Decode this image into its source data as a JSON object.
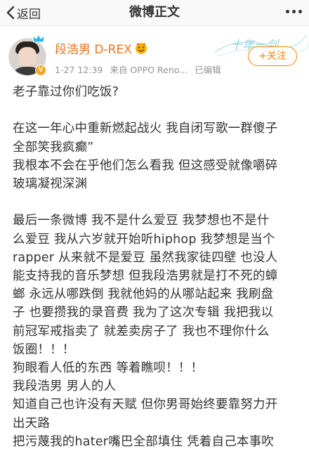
{
  "nav": {
    "back_label": "返回",
    "title": "微博正文"
  },
  "author": {
    "name": "段浩男 D-REX",
    "time": "1-27 12:39",
    "source": "来自 OPPO Reno...",
    "edited": "已编辑",
    "banner_text": "十年一剑"
  },
  "follow_button": "+关注",
  "post": {
    "line1": "老子靠过你们吃饭?",
    "line2": "在这一年心中重新燃起战火 我自闭写歌一群傻子",
    "line3": "全部笑我疯癫”",
    "line4": "我根本不会在乎他们怎么看我 但这感受就像嚼碎",
    "line5": "玻璃凝视深渊",
    "line6": "最后一条微博 我不是什么爱豆 我梦想也不是什",
    "line7": "么爱豆 我从六岁就开始听hiphop 我梦想是当个",
    "line8": "rapper 从来就不是爱豆 虽然我家徒四壁 也没人",
    "line9": "能支持我的音乐梦想 但我段浩男就是打不死的蟑",
    "line10": "螂 永远从哪跌倒 我就他妈的从哪站起来 我刷盘",
    "line11": "子 也要攒我的录音费 我为了这次专辑 我把我以",
    "line12": "前冠军戒指卖了 就差卖房子了 我也不理你什么",
    "line13": "饭圈！！！",
    "line14": "狗眼看人低的东西 等着瞧呗！！！",
    "line15": "我段浩男 男人的人",
    "line16": "知道自己也许没有天赋 但你男哥始终要靠努力开",
    "line17": "出天路",
    "line18": "把污蔑我的hater嘴巴全部填住 凭着自己本事吹"
  },
  "colors": {
    "username": "#e8741e",
    "follow": "#ff8200",
    "meta": "#939393",
    "text": "#333333"
  },
  "icons": [
    "back-chevron-icon",
    "more-icon",
    "verified-badge-icon",
    "crown-icon",
    "vip-face-icon"
  ]
}
